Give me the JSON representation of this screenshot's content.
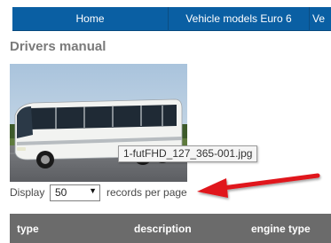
{
  "nav": {
    "items": [
      {
        "label": "Home"
      },
      {
        "label": "Vehicle models Euro 6"
      },
      {
        "label": "Ve"
      }
    ]
  },
  "page": {
    "title": "Drivers manual"
  },
  "image": {
    "tooltip": "1-futFHD_127_365-001.jpg"
  },
  "paging": {
    "display_label": "Display",
    "per_page_value": "50",
    "records_label": "records per page"
  },
  "table": {
    "columns": [
      "type",
      "description",
      "engine type"
    ]
  },
  "colors": {
    "nav_bg": "#0a5fa3",
    "header_bg": "#6b6b6b",
    "annotation_arrow": "#e0161b"
  },
  "icons": {
    "select_caret": "chevron-down-icon",
    "annotation": "red-arrow-icon"
  }
}
